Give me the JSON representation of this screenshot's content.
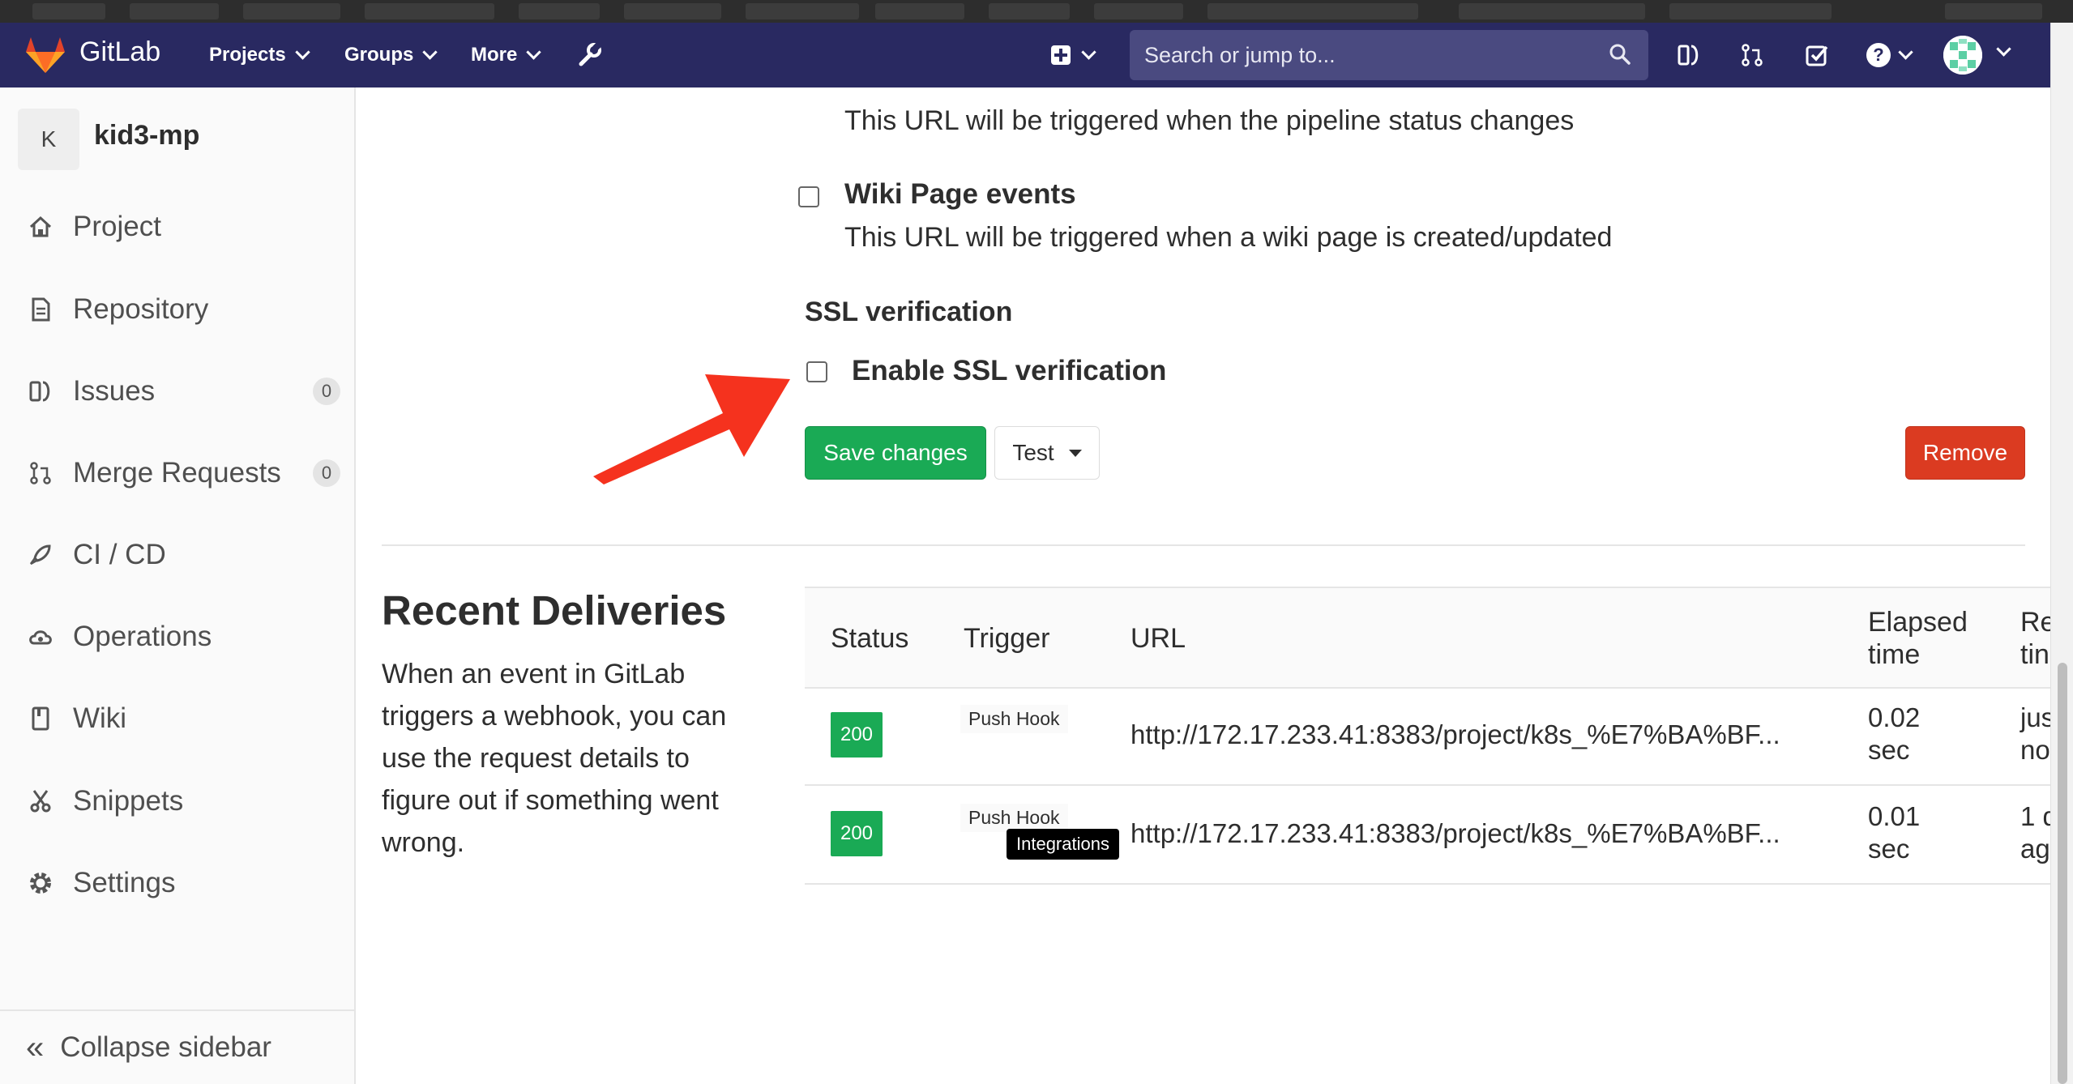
{
  "app": {
    "brand": "GitLab"
  },
  "nav": {
    "projects": "Projects",
    "groups": "Groups",
    "more": "More",
    "search_placeholder": "Search or jump to..."
  },
  "sidebar": {
    "project_letter": "K",
    "project_name": "kid3-mp",
    "items": [
      {
        "label": "Project",
        "icon": "home-icon"
      },
      {
        "label": "Repository",
        "icon": "doc-icon"
      },
      {
        "label": "Issues",
        "icon": "issues-icon",
        "badge": "0"
      },
      {
        "label": "Merge Requests",
        "icon": "merge-request-icon",
        "badge": "0"
      },
      {
        "label": "CI / CD",
        "icon": "rocket-icon"
      },
      {
        "label": "Operations",
        "icon": "cloud-gear-icon"
      },
      {
        "label": "Wiki",
        "icon": "book-icon"
      },
      {
        "label": "Snippets",
        "icon": "scissors-icon"
      },
      {
        "label": "Settings",
        "icon": "gear-icon"
      }
    ],
    "collapse": "Collapse sidebar"
  },
  "form": {
    "pipeline_desc": "This URL will be triggered when the pipeline status changes",
    "wiki_label": "Wiki Page events",
    "wiki_desc": "This URL will be triggered when a wiki page is created/updated",
    "ssl_heading": "SSL verification",
    "ssl_label": "Enable SSL verification",
    "save": "Save changes",
    "test": "Test",
    "remove": "Remove"
  },
  "deliveries": {
    "title": "Recent Deliveries",
    "description": "When an event in GitLab triggers a webhook, you can use the request details to figure out if something went wrong.",
    "headers": {
      "status": "Status",
      "trigger": "Trigger",
      "url": "URL",
      "elapsed_1": "Elapsed",
      "elapsed_2": "time",
      "request_1": "Re",
      "request_2": "tin"
    },
    "rows": [
      {
        "status": "200",
        "trigger": "Push Hook",
        "url": "http://172.17.233.41:8383/project/k8s_%E7%BA%BF...",
        "elapsed_1": "0.02",
        "elapsed_2": "sec",
        "req_1": "jus",
        "req_2": "no"
      },
      {
        "status": "200",
        "trigger": "Push Hook",
        "url": "http://172.17.233.41:8383/project/k8s_%E7%BA%BF...",
        "elapsed_1": "0.01",
        "elapsed_2": "sec",
        "req_1": "1 d",
        "req_2": "ag"
      }
    ],
    "tooltip": "Integrations"
  },
  "colors": {
    "navbar": "#292961",
    "green": "#1aaa55",
    "red": "#db3b21",
    "annotation_arrow": "#f5321e"
  }
}
